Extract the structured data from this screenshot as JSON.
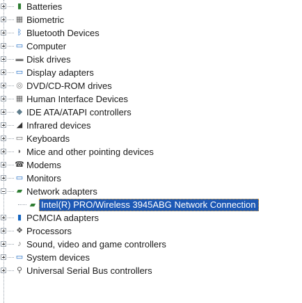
{
  "tree": {
    "items": [
      {
        "label": "Batteries",
        "icon": "battery-icon",
        "glyph": "🔋",
        "color": "#2e7d32"
      },
      {
        "label": "Biometric",
        "icon": "fingerprint-icon",
        "glyph": "▦",
        "color": "#6a6a6a"
      },
      {
        "label": "Bluetooth Devices",
        "icon": "bluetooth-icon",
        "glyph": "ᛒ",
        "color": "#1565c0"
      },
      {
        "label": "Computer",
        "icon": "computer-icon",
        "glyph": "🖥",
        "color": "#1565c0"
      },
      {
        "label": "Disk drives",
        "icon": "disk-drive-icon",
        "glyph": "▬",
        "color": "#777777"
      },
      {
        "label": "Display adapters",
        "icon": "display-adapter-icon",
        "glyph": "🖵",
        "color": "#1565c0"
      },
      {
        "label": "DVD/CD-ROM drives",
        "icon": "dvd-drive-icon",
        "glyph": "◎",
        "color": "#777777"
      },
      {
        "label": "Human Interface Devices",
        "icon": "hid-icon",
        "glyph": "▦",
        "color": "#6a6a6a"
      },
      {
        "label": "IDE ATA/ATAPI controllers",
        "icon": "ide-controller-icon",
        "glyph": "◆",
        "color": "#5f7d8c"
      },
      {
        "label": "Infrared devices",
        "icon": "infrared-icon",
        "glyph": "◢",
        "color": "#333333"
      },
      {
        "label": "Keyboards",
        "icon": "keyboard-icon",
        "glyph": "⌨",
        "color": "#666666"
      },
      {
        "label": "Mice and other pointing devices",
        "icon": "mouse-icon",
        "glyph": "🖱",
        "color": "#666666"
      },
      {
        "label": "Modems",
        "icon": "modem-icon",
        "glyph": "☎",
        "color": "#444444"
      },
      {
        "label": "Monitors",
        "icon": "monitor-icon",
        "glyph": "🖵",
        "color": "#1565c0"
      },
      {
        "label": "Network adapters",
        "icon": "network-adapter-icon",
        "glyph": "▰",
        "color": "#2e7d32"
      },
      {
        "label": "PCMCIA adapters",
        "icon": "pcmcia-icon",
        "glyph": "▮",
        "color": "#1565c0"
      },
      {
        "label": "Processors",
        "icon": "processor-icon",
        "glyph": "❖",
        "color": "#555555"
      },
      {
        "label": "Sound, video and game controllers",
        "icon": "sound-icon",
        "glyph": "♪",
        "color": "#777777"
      },
      {
        "label": "System devices",
        "icon": "system-devices-icon",
        "glyph": "🖥",
        "color": "#1565c0"
      },
      {
        "label": "Universal Serial Bus controllers",
        "icon": "usb-icon",
        "glyph": "⚲",
        "color": "#555555"
      }
    ],
    "network_child": {
      "label": "Intel(R) PRO/Wireless 3945ABG Network Connection",
      "icon": "network-card-icon",
      "glyph": "▰",
      "color": "#2e7d32"
    }
  },
  "colors": {
    "selection": "#1c58b5",
    "tree_lines": "#9aa3ad"
  }
}
